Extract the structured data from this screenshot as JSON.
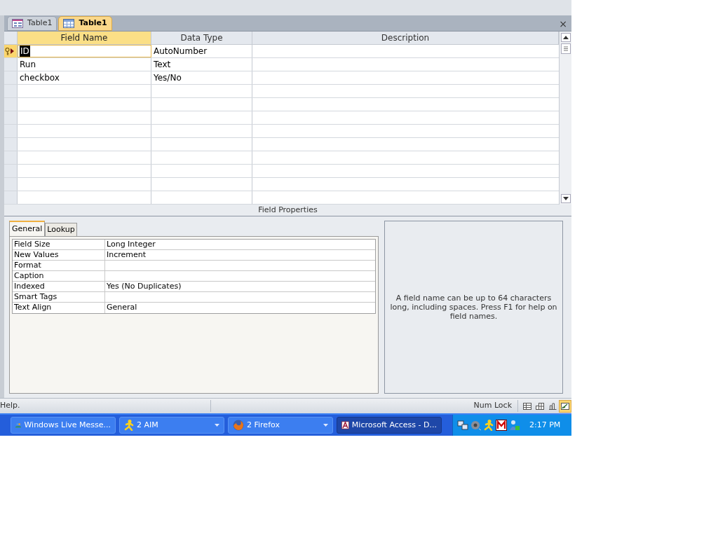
{
  "doc_tabs": [
    {
      "label": "Table1",
      "kind": "form",
      "selected": false
    },
    {
      "label": "Table1",
      "kind": "table",
      "selected": true
    }
  ],
  "close_glyph": "×",
  "grid": {
    "columns": [
      {
        "label": "Field Name",
        "selected": true
      },
      {
        "label": "Data Type",
        "selected": false
      },
      {
        "label": "Description",
        "selected": false
      }
    ],
    "rows": [
      {
        "field_name": "ID",
        "data_type": "AutoNumber",
        "primary_key": true,
        "selected": true
      },
      {
        "field_name": "Run",
        "data_type": "Text",
        "primary_key": false,
        "selected": false
      },
      {
        "field_name": "checkbox",
        "data_type": "Yes/No",
        "primary_key": false,
        "selected": false
      }
    ]
  },
  "field_properties": {
    "title": "Field Properties",
    "tabs": [
      {
        "label": "General",
        "selected": true
      },
      {
        "label": "Lookup",
        "selected": false
      }
    ],
    "properties": [
      {
        "label": "Field Size",
        "value": "Long Integer"
      },
      {
        "label": "New Values",
        "value": "Increment"
      },
      {
        "label": "Format"
      },
      {
        "label": "Caption"
      },
      {
        "label": "Indexed",
        "value": "Yes (No Duplicates)"
      },
      {
        "label": "Smart Tags"
      },
      {
        "label": "Text Align",
        "value": "General"
      }
    ],
    "help_text": "A field name can be up to 64 characters long, including spaces. Press F1 for help on field names."
  },
  "status_bar": {
    "message": "Help.",
    "indicator": "Num Lock",
    "views": [
      {
        "kind": "datasheet",
        "selected": false
      },
      {
        "kind": "pivot-table",
        "selected": false
      },
      {
        "kind": "pivot-chart",
        "selected": false
      },
      {
        "kind": "design",
        "selected": true
      }
    ]
  },
  "taskbar": {
    "buttons": [
      {
        "label": "Windows Live Messe...",
        "kind": "messenger",
        "has_menu": false,
        "selected": false
      },
      {
        "label": "2 AIM",
        "kind": "aim",
        "has_menu": true,
        "selected": false
      },
      {
        "label": "2 Firefox",
        "kind": "firefox",
        "has_menu": true,
        "selected": false
      },
      {
        "label": "Microsoft Access - D...",
        "kind": "access",
        "has_menu": false,
        "selected": true
      }
    ],
    "clock": "2:17 PM"
  }
}
